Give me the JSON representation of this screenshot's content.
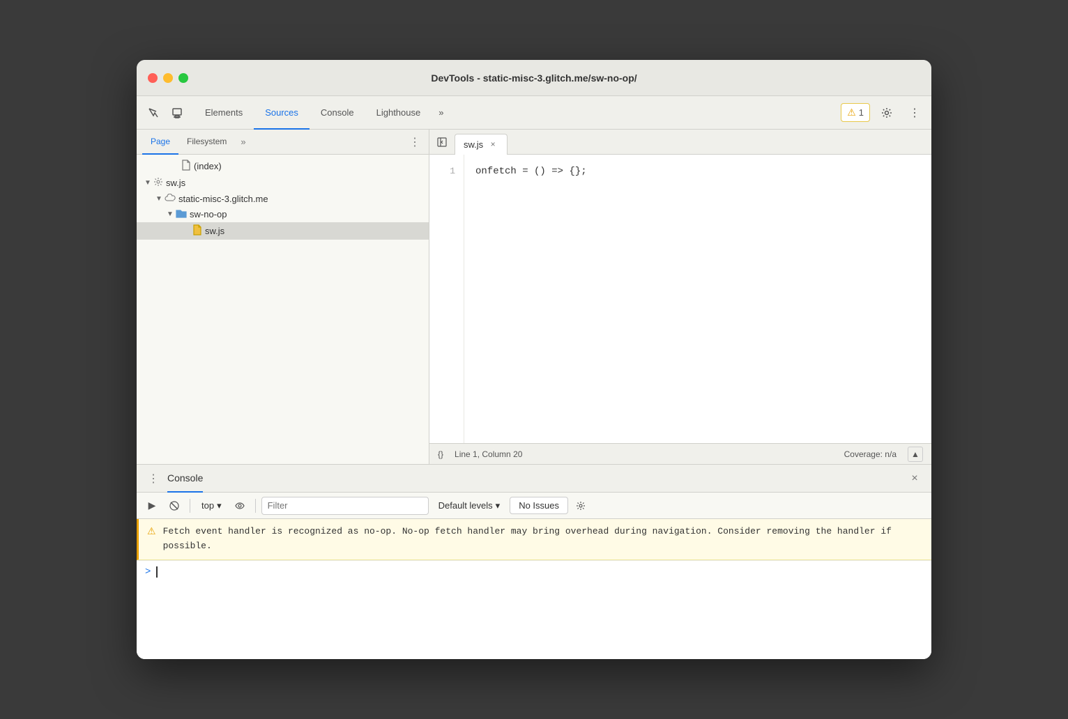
{
  "window": {
    "title": "DevTools - static-misc-3.glitch.me/sw-no-op/",
    "close_label": "×",
    "minimize_label": "−",
    "maximize_label": "+"
  },
  "nav": {
    "tabs": [
      {
        "id": "elements",
        "label": "Elements",
        "active": false
      },
      {
        "id": "sources",
        "label": "Sources",
        "active": true
      },
      {
        "id": "console",
        "label": "Console",
        "active": false
      },
      {
        "id": "lighthouse",
        "label": "Lighthouse",
        "active": false
      }
    ],
    "more_label": "»",
    "warning_count": "1",
    "settings_label": "⚙",
    "more_menu_label": "⋮"
  },
  "left_panel": {
    "tabs": [
      {
        "id": "page",
        "label": "Page",
        "active": true
      },
      {
        "id": "filesystem",
        "label": "Filesystem",
        "active": false
      }
    ],
    "more_label": "»",
    "menu_label": "⋮",
    "file_tree": [
      {
        "id": "index",
        "label": "(index)",
        "indent": 3,
        "icon": "doc",
        "arrow": ""
      },
      {
        "id": "sw-js-root",
        "label": "sw.js",
        "indent": 1,
        "icon": "gear",
        "arrow": "▼"
      },
      {
        "id": "domain",
        "label": "static-misc-3.glitch.me",
        "indent": 2,
        "icon": "cloud",
        "arrow": "▼"
      },
      {
        "id": "sw-no-op-folder",
        "label": "sw-no-op",
        "indent": 3,
        "icon": "folder",
        "arrow": "▼"
      },
      {
        "id": "sw-js-file",
        "label": "sw.js",
        "indent": 4,
        "icon": "js",
        "arrow": "",
        "selected": true
      }
    ]
  },
  "editor": {
    "sidebar_btn": "◁",
    "tab_label": "sw.js",
    "tab_close": "×",
    "code_lines": [
      {
        "num": "1",
        "content": "onfetch = () => {};"
      }
    ],
    "status": {
      "format_label": "{}",
      "position": "Line 1, Column 20",
      "coverage": "Coverage: n/a",
      "scroll_up": "▲"
    }
  },
  "console_panel": {
    "header_title": "Console",
    "close_label": "×",
    "menu_label": "⋮",
    "toolbar": {
      "clear_btn": "🚫",
      "run_btn": "▶",
      "block_btn": "⊘",
      "top_label": "top",
      "dropdown_arrow": "▾",
      "eye_btn": "👁",
      "filter_placeholder": "Filter",
      "levels_label": "Default levels",
      "levels_arrow": "▾",
      "issues_label": "No Issues",
      "settings_btn": "⚙"
    },
    "warning": {
      "icon": "⚠",
      "text": "Fetch event handler is recognized as no-op. No-op fetch handler may\nbring overhead during navigation. Consider removing the handler if\npossible."
    },
    "input_prompt": ">"
  }
}
